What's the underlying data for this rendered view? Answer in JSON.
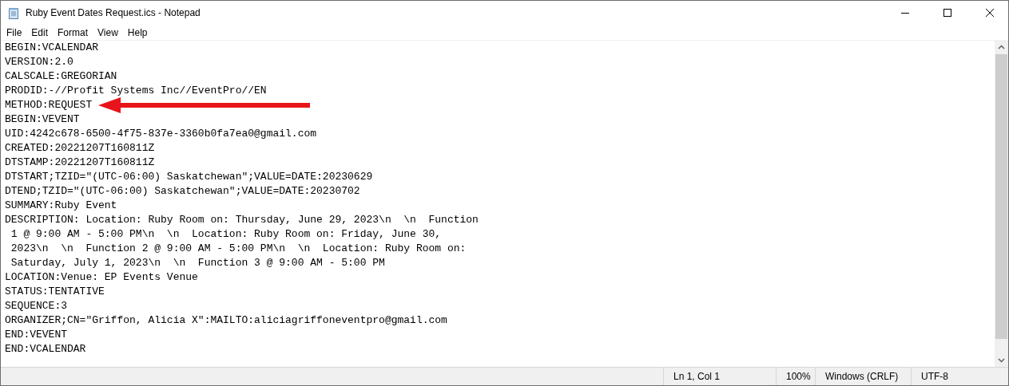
{
  "window": {
    "title": "Ruby Event Dates Request.ics - Notepad"
  },
  "menu": [
    "File",
    "Edit",
    "Format",
    "View",
    "Help"
  ],
  "lines": [
    "BEGIN:VCALENDAR",
    "VERSION:2.0",
    "CALSCALE:GREGORIAN",
    "PRODID:-//Profit Systems Inc//EventPro//EN",
    "METHOD:REQUEST",
    "BEGIN:VEVENT",
    "UID:4242c678-6500-4f75-837e-3360b0fa7ea0@gmail.com",
    "CREATED:20221207T160811Z",
    "DTSTAMP:20221207T160811Z",
    "DTSTART;TZID=\"(UTC-06:00) Saskatchewan\";VALUE=DATE:20230629",
    "DTEND;TZID=\"(UTC-06:00) Saskatchewan\";VALUE=DATE:20230702",
    "SUMMARY:Ruby Event",
    "DESCRIPTION: Location: Ruby Room on: Thursday, June 29, 2023\\n  \\n  Function",
    " 1 @ 9:00 AM - 5:00 PM\\n  \\n  Location: Ruby Room on: Friday, June 30,",
    " 2023\\n  \\n  Function 2 @ 9:00 AM - 5:00 PM\\n  \\n  Location: Ruby Room on:",
    " Saturday, July 1, 2023\\n  \\n  Function 3 @ 9:00 AM - 5:00 PM",
    "LOCATION:Venue: EP Events Venue",
    "STATUS:TENTATIVE",
    "SEQUENCE:3",
    "ORGANIZER;CN=\"Griffon, Alicia X\":MAILTO:aliciagriffoneventpro@gmail.com",
    "END:VEVENT",
    "END:VCALENDAR"
  ],
  "status_bar": [
    "Ln 1, Col 1",
    "100%",
    "Windows (CRLF)",
    "UTF-8"
  ]
}
